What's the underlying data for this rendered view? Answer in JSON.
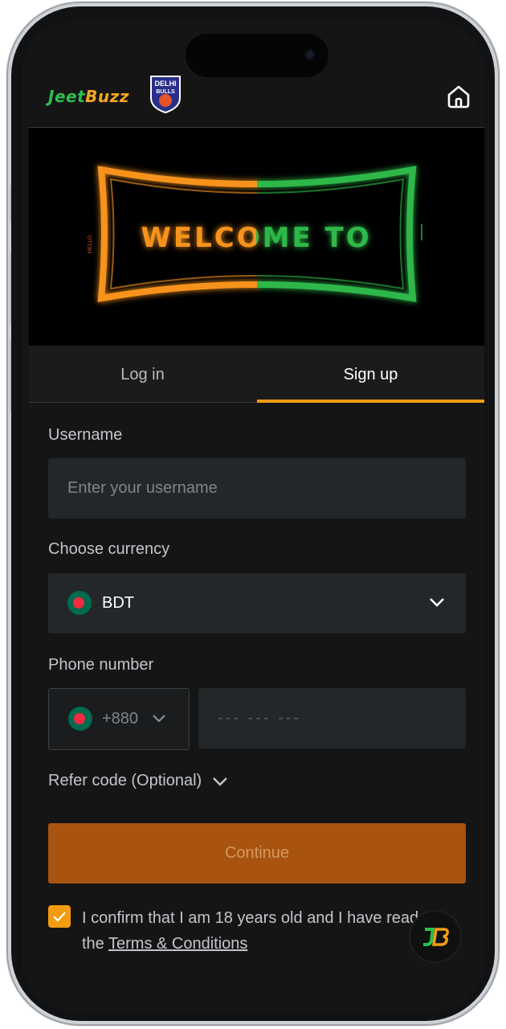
{
  "header": {
    "logo_text_part1": "Jeet",
    "logo_text_part2": "Buzz",
    "badge_text_top": "DELHI",
    "badge_text_bottom": "BULLS"
  },
  "banner": {
    "headline": "WELCOME TO",
    "side_text": "HELLO"
  },
  "tabs": {
    "login": "Log in",
    "signup": "Sign up"
  },
  "form": {
    "username_label": "Username",
    "username_placeholder": "Enter your username",
    "currency_label": "Choose currency",
    "currency_value": "BDT",
    "phone_label": "Phone number",
    "dial_code": "+880",
    "phone_placeholder": "--- --- ---",
    "refer_label": "Refer code (Optional)",
    "continue_label": "Continue",
    "confirm_text": "I confirm that I am 18 years old and I have read",
    "confirm_the": "the",
    "terms_link": "Terms & Conditions"
  },
  "colors": {
    "accent": "#f39c12",
    "continue_bg": "#a8530f",
    "screen_bg": "#151515",
    "input_bg": "#232729"
  }
}
